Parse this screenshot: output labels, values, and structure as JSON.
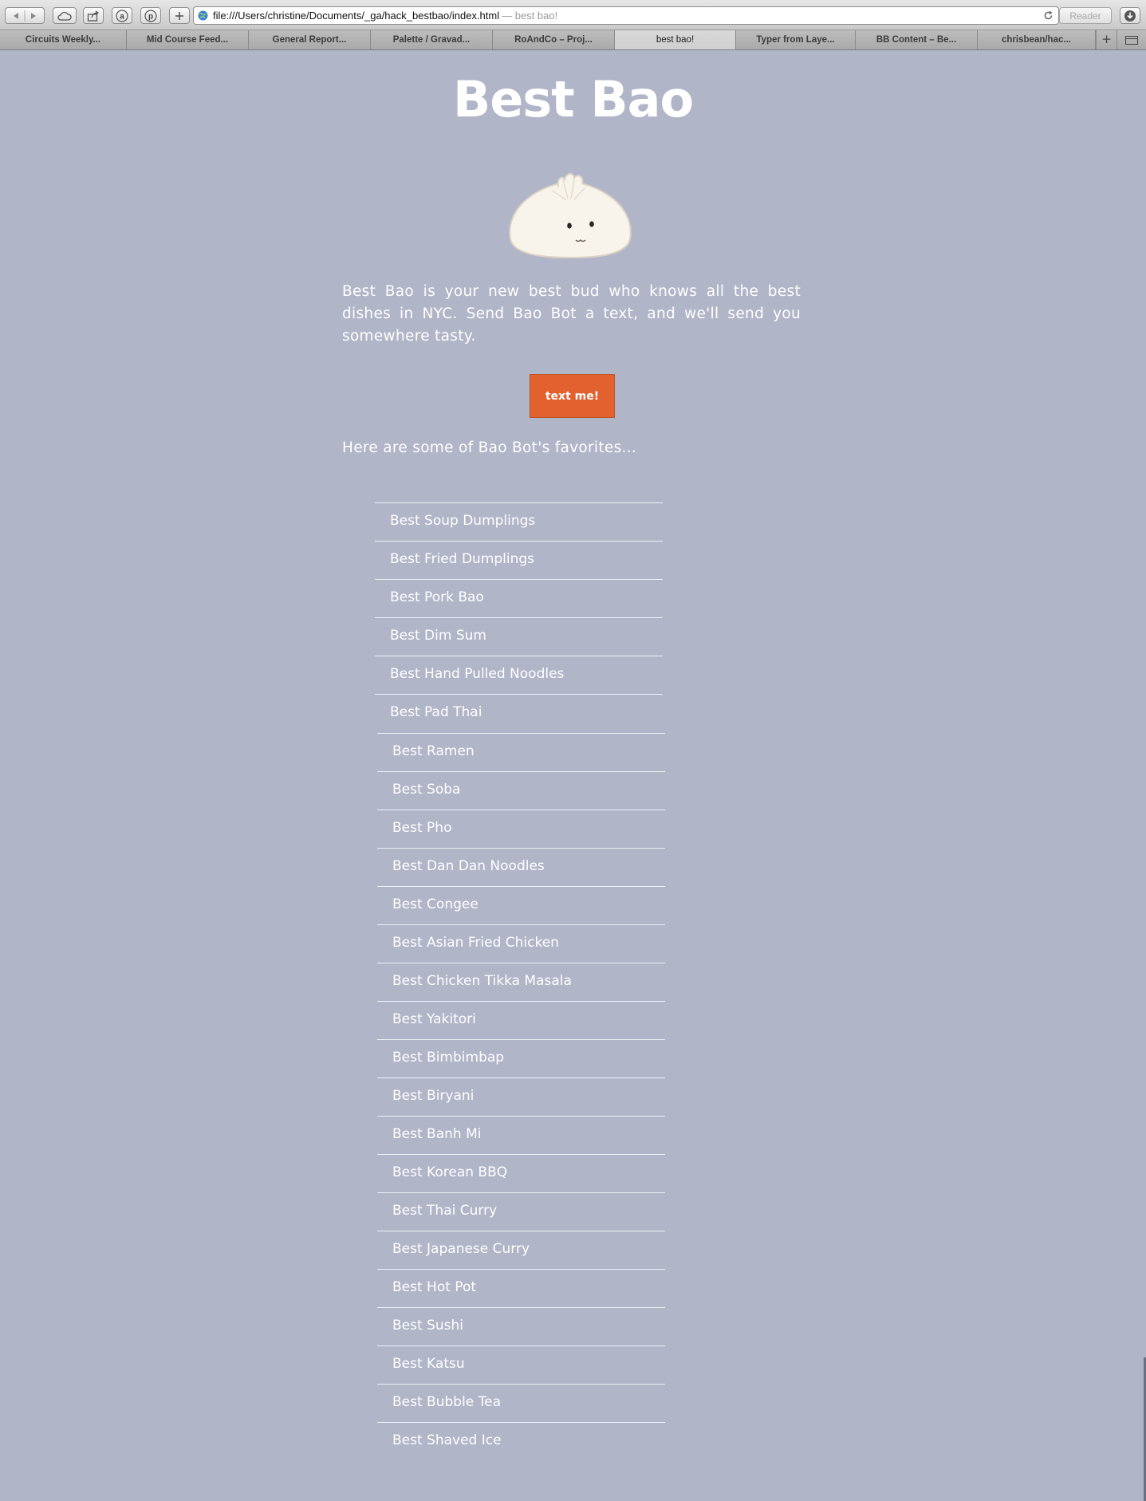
{
  "browser": {
    "url": "file:///Users/christine/Documents/_ga/hack_bestbao/index.html",
    "title_suffix": "— best bao!",
    "reader_label": "Reader",
    "tabs": [
      {
        "label": "Circuits Weekly..."
      },
      {
        "label": "Mid Course Feed..."
      },
      {
        "label": "General Report..."
      },
      {
        "label": "Palette / Gravad..."
      },
      {
        "label": "RoAndCo – Proj..."
      },
      {
        "label": "best bao!",
        "active": true
      },
      {
        "label": "Typer from Laye..."
      },
      {
        "label": "BB Content – Be..."
      },
      {
        "label": "chrisbean/hac..."
      }
    ],
    "new_tab_label": "+"
  },
  "page": {
    "title": "Best Bao",
    "intro": "Best Bao is your new best bud who knows all the best dishes in NYC. Send Bao Bot a text, and we'll send you somewhere tasty.",
    "cta_label": "text me!",
    "favorites_heading": "Here are some of Bao Bot's favorites...",
    "favorites": [
      "Best Soup Dumplings",
      "Best Fried Dumplings",
      "Best Pork Bao",
      "Best Dim Sum",
      "Best Hand Pulled Noodles",
      "Best Pad Thai",
      "Best Ramen",
      "Best Soba",
      "Best Pho",
      "Best Dan Dan Noodles",
      "Best Congee",
      "Best Asian Fried Chicken",
      "Best Chicken Tikka Masala",
      "Best Yakitori",
      "Best Bimbimbap",
      "Best Biryani",
      "Best Banh Mi",
      "Best Korean BBQ",
      "Best Thai Curry",
      "Best Japanese Curry",
      "Best Hot Pot",
      "Best Sushi",
      "Best Katsu",
      "Best Bubble Tea",
      "Best Shaved Ice"
    ]
  },
  "colors": {
    "page_background": "#b1b5c8",
    "accent_button": "#e2612f",
    "text": "#ffffff"
  }
}
